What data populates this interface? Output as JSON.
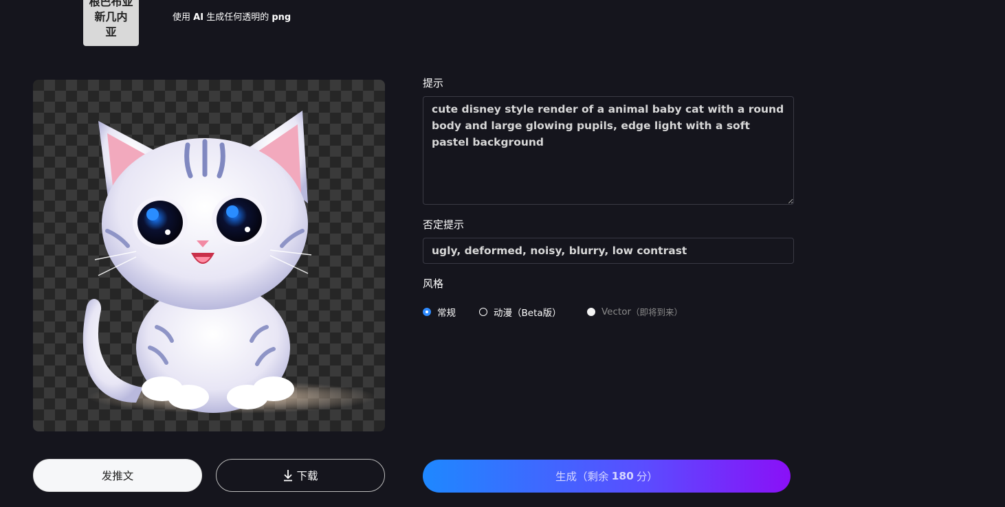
{
  "header": {
    "logo_lines": [
      "根巴布亚",
      "新几内",
      "亚"
    ],
    "tagline_prefix": "使用",
    "tagline_ai": "AI",
    "tagline_middle": "生成任何透明的",
    "tagline_png": "png"
  },
  "form": {
    "prompt_label": "提示",
    "prompt_value": "cute disney style render of a animal baby cat with a round body and large glowing pupils, edge light with a soft pastel background",
    "negative_label": "否定提示",
    "negative_value": "ugly, deformed, noisy, blurry, low contrast",
    "style_label": "风格",
    "styles": [
      {
        "label": "常规",
        "state": "selected"
      },
      {
        "label": "动漫（Beta版）",
        "state": "unselected"
      },
      {
        "label": "Vector",
        "suffix": "（即将到来）",
        "state": "disabled"
      }
    ]
  },
  "actions": {
    "post_label": "发推文",
    "download_label": "下载",
    "generate_prefix": "生成（剩余",
    "generate_count": "180",
    "generate_suffix": "分）"
  },
  "colors": {
    "background": "#15151d",
    "accent_blue": "#1e88ff",
    "accent_purple": "#8a10f7"
  },
  "icons": {
    "download": "download-icon"
  }
}
